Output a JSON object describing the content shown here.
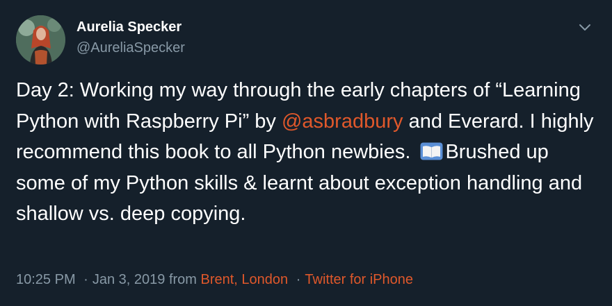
{
  "author": {
    "name": "Aurelia Specker",
    "handle": "@AureliaSpecker"
  },
  "tweet": {
    "text_part1": "Day 2: Working my way through the early chapters of “Learning Python with Raspberry Pi” by ",
    "mention": "@asbradbury",
    "text_part2": " and Everard. I highly recommend this book to all Python newbies. ",
    "text_part3": "Brushed up some of my Python skills & learnt about exception handling and shallow vs. deep copying."
  },
  "meta": {
    "time": "10:25 PM",
    "date": "Jan 3, 2019",
    "from_label": "from",
    "location": "Brent, London",
    "source": "Twitter for iPhone",
    "separator": "·"
  },
  "icons": {
    "menu": "chevron-down-icon",
    "book": "open-book-emoji"
  },
  "colors": {
    "background": "#15202b",
    "text": "#ffffff",
    "secondary": "#8899a6",
    "accent": "#e0582b"
  }
}
